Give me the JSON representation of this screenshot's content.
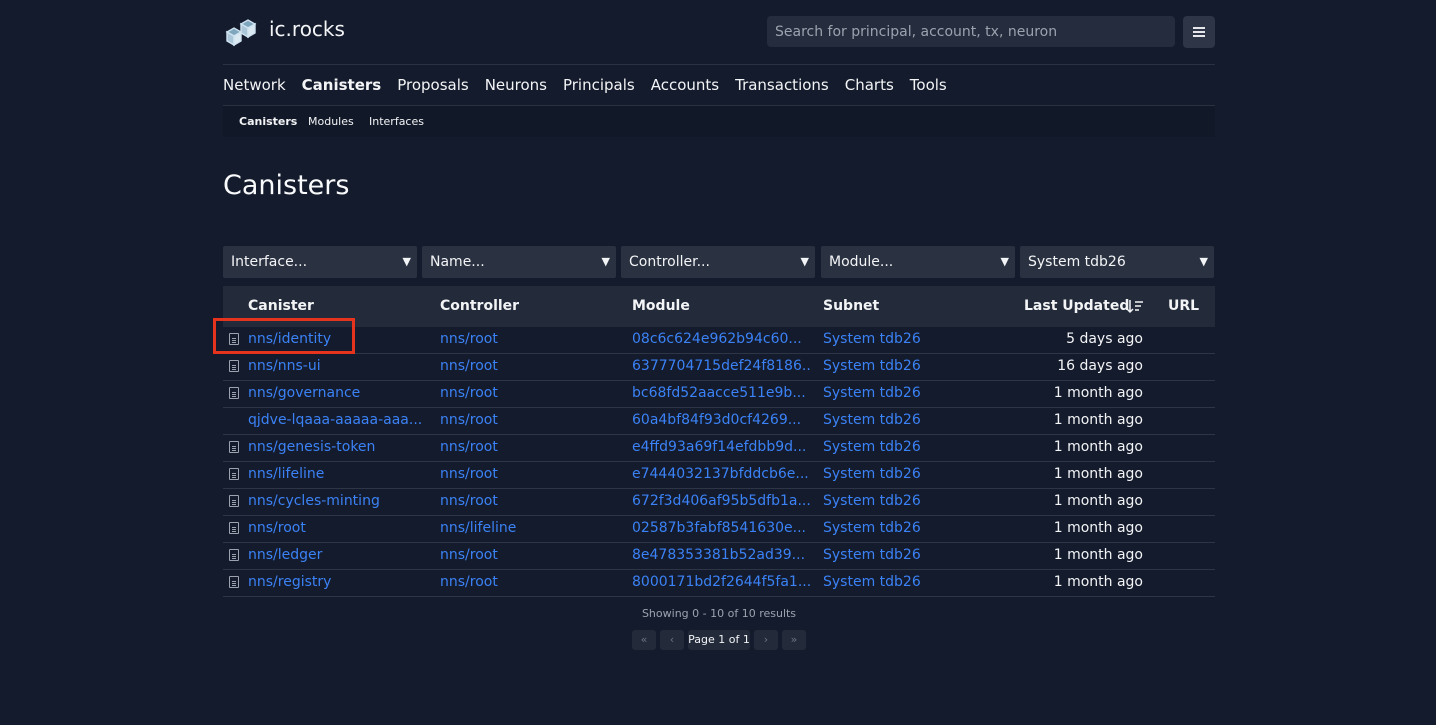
{
  "brand": "ic.rocks",
  "search": {
    "placeholder": "Search for principal, account, tx, neuron"
  },
  "nav": [
    "Network",
    "Canisters",
    "Proposals",
    "Neurons",
    "Principals",
    "Accounts",
    "Transactions",
    "Charts",
    "Tools"
  ],
  "nav_active": "Canisters",
  "subnav": [
    "Canisters",
    "Modules",
    "Interfaces"
  ],
  "page_title": "Canisters",
  "filters": [
    "Interface...",
    "Name...",
    "Controller...",
    "Module...",
    "System tdb26"
  ],
  "table": {
    "headers": {
      "canister": "Canister",
      "controller": "Controller",
      "module": "Module",
      "subnet": "Subnet",
      "last_updated": "Last Updated",
      "url": "URL"
    },
    "rows": [
      {
        "canister": "nns/identity",
        "controller": "nns/root",
        "module": "08c6c624e962b94c60...",
        "subnet": "System tdb26",
        "updated": "5 days ago",
        "icon": true
      },
      {
        "canister": "nns/nns-ui",
        "controller": "nns/root",
        "module": "6377704715def24f8186...",
        "subnet": "System tdb26",
        "updated": "16 days ago",
        "icon": true
      },
      {
        "canister": "nns/governance",
        "controller": "nns/root",
        "module": "bc68fd52aacce511e9b...",
        "subnet": "System tdb26",
        "updated": "1 month ago",
        "icon": true
      },
      {
        "canister": "qjdve-lqaaa-aaaaa-aaa...",
        "controller": "nns/root",
        "module": "60a4bf84f93d0cf4269...",
        "subnet": "System tdb26",
        "updated": "1 month ago",
        "icon": false
      },
      {
        "canister": "nns/genesis-token",
        "controller": "nns/root",
        "module": "e4ffd93a69f14efdbb9d...",
        "subnet": "System tdb26",
        "updated": "1 month ago",
        "icon": true
      },
      {
        "canister": "nns/lifeline",
        "controller": "nns/root",
        "module": "e7444032137bfddcb6e...",
        "subnet": "System tdb26",
        "updated": "1 month ago",
        "icon": true
      },
      {
        "canister": "nns/cycles-minting",
        "controller": "nns/root",
        "module": "672f3d406af95b5dfb1a...",
        "subnet": "System tdb26",
        "updated": "1 month ago",
        "icon": true
      },
      {
        "canister": "nns/root",
        "controller": "nns/lifeline",
        "module": "02587b3fabf8541630e...",
        "subnet": "System tdb26",
        "updated": "1 month ago",
        "icon": true
      },
      {
        "canister": "nns/ledger",
        "controller": "nns/root",
        "module": "8e478353381b52ad39...",
        "subnet": "System tdb26",
        "updated": "1 month ago",
        "icon": true
      },
      {
        "canister": "nns/registry",
        "controller": "nns/root",
        "module": "8000171bd2f2644f5fa1...",
        "subnet": "System tdb26",
        "updated": "1 month ago",
        "icon": true
      }
    ]
  },
  "results_text": "Showing 0 - 10 of 10 results",
  "pager": {
    "first": "«",
    "prev": "‹",
    "page_info": "Page 1 of 1",
    "next": "›",
    "last": "»"
  },
  "colors": {
    "background": "#141b2c",
    "link": "#3b82f6",
    "highlight": "#e5331e"
  }
}
